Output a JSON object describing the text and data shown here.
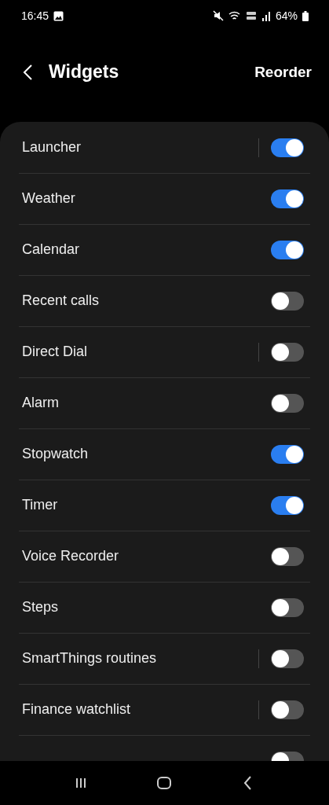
{
  "status_bar": {
    "time": "16:45",
    "battery": "64%"
  },
  "header": {
    "title": "Widgets",
    "action": "Reorder"
  },
  "widgets": [
    {
      "label": "Launcher",
      "on": true,
      "split": true
    },
    {
      "label": "Weather",
      "on": true,
      "split": false
    },
    {
      "label": "Calendar",
      "on": true,
      "split": false
    },
    {
      "label": "Recent calls",
      "on": false,
      "split": false
    },
    {
      "label": "Direct Dial",
      "on": false,
      "split": true
    },
    {
      "label": "Alarm",
      "on": false,
      "split": false
    },
    {
      "label": "Stopwatch",
      "on": true,
      "split": false
    },
    {
      "label": "Timer",
      "on": true,
      "split": false
    },
    {
      "label": "Voice Recorder",
      "on": false,
      "split": false
    },
    {
      "label": "Steps",
      "on": false,
      "split": false
    },
    {
      "label": "SmartThings routines",
      "on": false,
      "split": true
    },
    {
      "label": "Finance watchlist",
      "on": false,
      "split": true
    },
    {
      "on": false,
      "split": false
    }
  ]
}
